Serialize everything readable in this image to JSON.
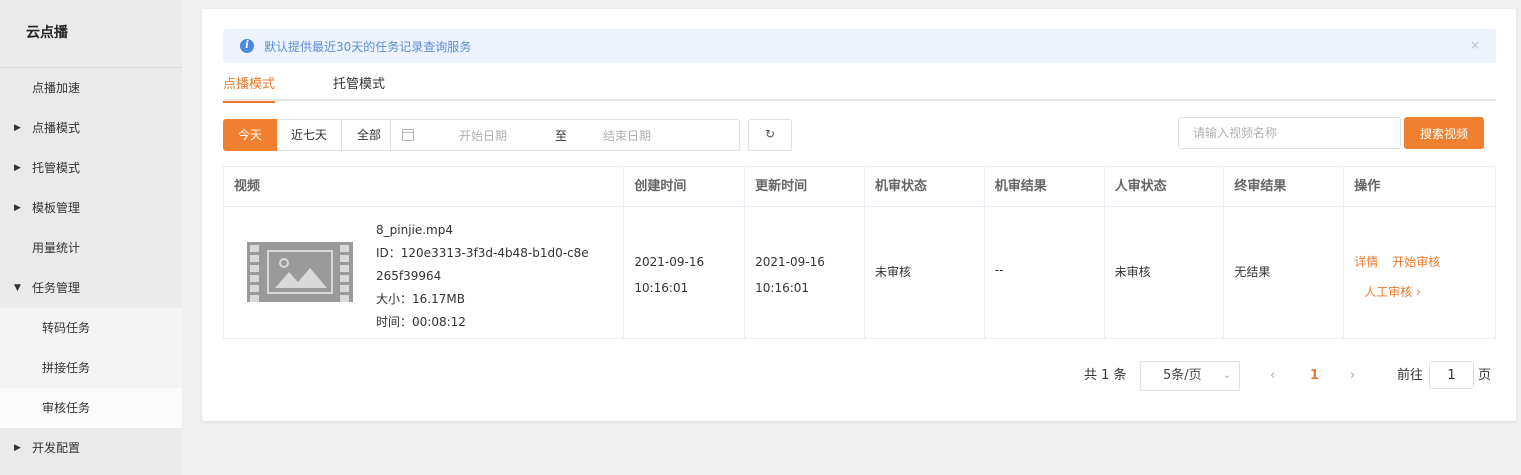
{
  "sidebar": {
    "title": "云点播",
    "items": [
      {
        "label": "点播加速"
      },
      {
        "label": "点播模式"
      },
      {
        "label": "托管模式"
      },
      {
        "label": "模板管理"
      },
      {
        "label": "用量统计"
      },
      {
        "label": "任务管理"
      },
      {
        "label": "转码任务"
      },
      {
        "label": "拼接任务"
      },
      {
        "label": "审核任务"
      },
      {
        "label": "开发配置"
      }
    ]
  },
  "notice": {
    "text": "默认提供最近30天的任务记录查询服务",
    "close": "×",
    "icon_glyph": "i"
  },
  "tabs": [
    {
      "label": "点播模式"
    },
    {
      "label": "托管模式"
    }
  ],
  "filter": {
    "today": "今天",
    "week": "近七天",
    "all": "全部",
    "start_placeholder": "开始日期",
    "separator": "至",
    "end_placeholder": "结束日期",
    "refresh": "↻"
  },
  "search": {
    "placeholder": "请输入视频名称",
    "button": "搜索视频"
  },
  "table": {
    "headers": [
      "视频",
      "创建时间",
      "更新时间",
      "机审状态",
      "机审结果",
      "人审状态",
      "终审结果",
      "操作"
    ],
    "rows": [
      {
        "video_name": "8_pinjie.mp4",
        "video_id_line1": "ID：120e3313-3f3d-4b48-b1d0-c8e",
        "video_id_line2": "265f39964",
        "size": "大小：16.17MB",
        "duration": "时间：00:08:12",
        "created": "2021-09-16 10:16:01",
        "updated": "2021-09-16 10:16:01",
        "machine_status": "未审核",
        "machine_result": "--",
        "human_status": "未审核",
        "final_result": "无结果",
        "actions": {
          "detail": "详情",
          "start_review": "开始审核",
          "manual_review": "人工审核 ›"
        }
      }
    ]
  },
  "pagination": {
    "total": "共 1 条",
    "page_size": "5条/页",
    "page_size_arrow": "⌄",
    "prev": "‹",
    "current": "1",
    "next": "›",
    "goto_label": "前往",
    "goto_value": "1",
    "goto_unit": "页"
  },
  "colors": {
    "accent": "#f07f2f",
    "notice_bg": "#ecf3fc",
    "notice_text": "#5b8fd6"
  }
}
